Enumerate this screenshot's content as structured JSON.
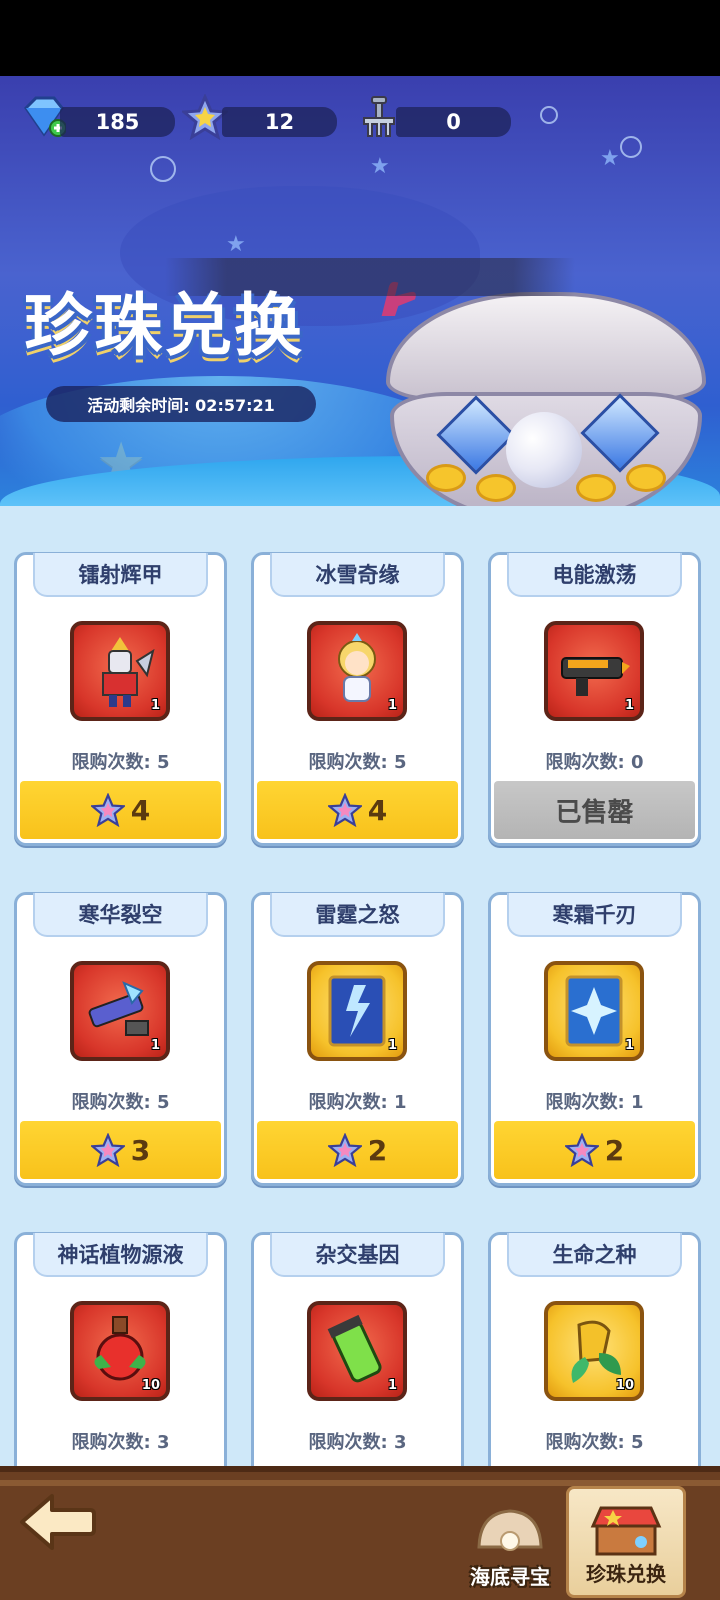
{
  "header": {
    "currencies": [
      {
        "name": "gem",
        "icon": "diamond-plus-icon",
        "value": "185"
      },
      {
        "name": "star",
        "icon": "star-shell-icon",
        "value": "12"
      },
      {
        "name": "rake",
        "icon": "rake-icon",
        "value": "0"
      }
    ],
    "title": "珍珠兑换",
    "timer": "活动剩余时间: 02:57:21"
  },
  "shop": {
    "items": [
      {
        "name": "镭射辉甲",
        "icon": "laser-armor-robot-icon",
        "bg": "red",
        "qty": "1",
        "limit": "限购次数: 5",
        "price": "4",
        "sold": false
      },
      {
        "name": "冰雪奇缘",
        "icon": "ice-prince-character-icon",
        "bg": "red",
        "qty": "1",
        "limit": "限购次数: 5",
        "price": "4",
        "sold": false
      },
      {
        "name": "电能激荡",
        "icon": "electric-gun-icon",
        "bg": "red",
        "qty": "1",
        "limit": "限购次数: 0",
        "price": "已售罄",
        "sold": true
      },
      {
        "name": "寒华裂空",
        "icon": "ice-cannon-icon",
        "bg": "red",
        "qty": "1",
        "limit": "限购次数: 5",
        "price": "3",
        "sold": false
      },
      {
        "name": "雷霆之怒",
        "icon": "thunder-card-icon",
        "bg": "gold",
        "qty": "1",
        "limit": "限购次数: 1",
        "price": "2",
        "sold": false
      },
      {
        "name": "寒霜千刃",
        "icon": "frost-card-icon",
        "bg": "gold",
        "qty": "1",
        "limit": "限购次数: 1",
        "price": "2",
        "sold": false
      },
      {
        "name": "神话植物源液",
        "icon": "potion-flask-icon",
        "bg": "red",
        "qty": "10",
        "limit": "限购次数: 3",
        "price": "",
        "sold": false
      },
      {
        "name": "杂交基因",
        "icon": "gene-tube-icon",
        "bg": "red",
        "qty": "1",
        "limit": "限购次数: 3",
        "price": "",
        "sold": false
      },
      {
        "name": "生命之种",
        "icon": "life-seed-icon",
        "bg": "gold",
        "qty": "10",
        "limit": "限购次数: 5",
        "price": "",
        "sold": false
      }
    ]
  },
  "nav": {
    "back": "back-arrow-icon",
    "tabs": [
      {
        "label": "海底寻宝",
        "icon": "shell-icon",
        "active": false
      },
      {
        "label": "珍珠兑换",
        "icon": "shop-stall-icon",
        "active": true
      }
    ]
  }
}
